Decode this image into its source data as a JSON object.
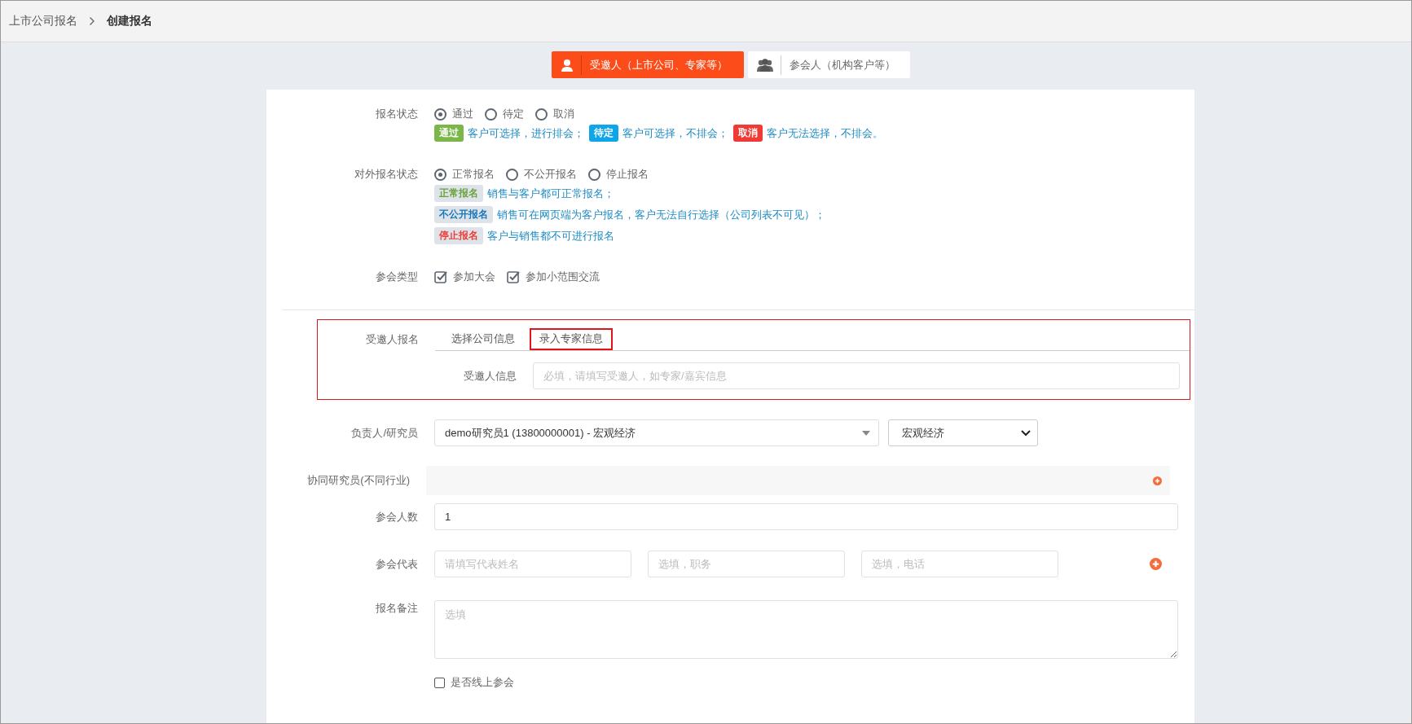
{
  "breadcrumb": [
    {
      "label": "上市公司报名",
      "current": false
    },
    {
      "label": "创建报名",
      "current": true
    }
  ],
  "role_tabs": [
    {
      "label": "受邀人（上市公司、专家等）",
      "selected": true,
      "kind": "single"
    },
    {
      "label": "参会人（机构客户等）",
      "selected": false,
      "kind": "group"
    }
  ],
  "signup_status": {
    "label": "报名状态",
    "options": [
      {
        "label": "通过",
        "selected": true
      },
      {
        "label": "待定",
        "selected": false
      },
      {
        "label": "取消",
        "selected": false
      }
    ],
    "legend": [
      {
        "kind": "solid",
        "tag": "通过",
        "text": "客户可选择，进行排会；",
        "color": "#7ab648"
      },
      {
        "kind": "solid",
        "tag": "待定",
        "text": "客户可选择，不排会；",
        "color": "#0ea5e9"
      },
      {
        "kind": "solid",
        "tag": "取消",
        "text": "客户无法选择，不排会。",
        "color": "#ef3b33"
      }
    ]
  },
  "external_status": {
    "label": "对外报名状态",
    "options": [
      {
        "label": "正常报名",
        "selected": true
      },
      {
        "label": "不公开报名",
        "selected": false
      },
      {
        "label": "停止报名",
        "selected": false
      }
    ],
    "legend": [
      {
        "kind": "soft",
        "tag": "正常报名",
        "text": "销售与客户都可正常报名；",
        "color": "#6aa33a"
      },
      {
        "kind": "soft",
        "tag": "不公开报名",
        "text": "销售可在网页端为客户报名，客户无法自行选择（公司列表不可见）；",
        "color": "#1777b8"
      },
      {
        "kind": "soft",
        "tag": "停止报名",
        "text": "客户与销售都不可进行报名",
        "color": "#ef3b33"
      }
    ]
  },
  "meeting_type": {
    "label": "参会类型",
    "options": [
      {
        "label": "参加大会",
        "checked": true
      },
      {
        "label": "参加小范围交流",
        "checked": true
      }
    ]
  },
  "invitee": {
    "label": "受邀人报名",
    "tabs": [
      {
        "label": "选择公司信息",
        "selected": false
      },
      {
        "label": "录入专家信息",
        "selected": true
      }
    ],
    "field_label": "受邀人信息",
    "placeholder": "必填，请填写受邀人，如专家/嘉宾信息"
  },
  "researcher": {
    "label": "负责人/研究员",
    "value": "demo研究员1 (13800000001) - 宏观经济",
    "industry": "宏观经济"
  },
  "co_researcher": {
    "label": "协同研究员(不同行业)"
  },
  "attendee_count": {
    "label": "参会人数",
    "value": "1"
  },
  "representative": {
    "label": "参会代表",
    "placeholders": [
      "请填写代表姓名",
      "选填，职务",
      "选填，电话"
    ]
  },
  "remarks": {
    "label": "报名备注",
    "placeholder": "选填"
  },
  "online": {
    "label": "是否线上参会",
    "checked": false
  }
}
